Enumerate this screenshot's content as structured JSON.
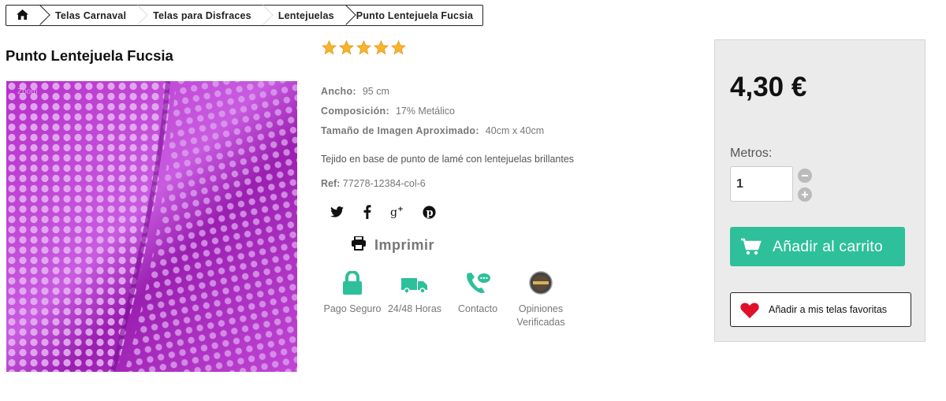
{
  "breadcrumb": {
    "home_icon": "home-icon",
    "items": [
      "Telas Carnaval",
      "Telas para Disfraces",
      "Lentejuelas",
      "Punto Lentejuela Fucsia"
    ]
  },
  "product": {
    "title": "Punto Lentejuela Fucsia",
    "zoom_hint": "Zoom",
    "rating": 5,
    "rating_max": 5,
    "specs": [
      {
        "key": "Ancho:",
        "value": "95 cm"
      },
      {
        "key": "Composición:",
        "value": "17%  Metálico"
      },
      {
        "key": "Tamaño de Imagen Aproximado:",
        "value": "40cm x 40cm"
      }
    ],
    "description": "Tejido en base de punto de lamé con lentejuelas brillantes",
    "ref_key": "Ref:",
    "ref_value": "77278-12384-col-6",
    "image_color": "#c03fd0"
  },
  "social": [
    "twitter-icon",
    "facebook-icon",
    "google-plus-icon",
    "pinterest-icon"
  ],
  "print_label": "Imprimir",
  "features": [
    {
      "label": "Pago Seguro",
      "icon": "lock-icon"
    },
    {
      "label": "24/48 Horas",
      "icon": "truck-icon"
    },
    {
      "label": "Contacto",
      "icon": "phone-chat-icon"
    },
    {
      "label": "Opiniones Verificadas",
      "icon": "verified-reviews-icon"
    }
  ],
  "purchase": {
    "price": "4,30 €",
    "quantity_label": "Metros:",
    "quantity_value": "1",
    "add_to_cart": "Añadir al carrito",
    "favorites": "Añadir a mis telas favoritas"
  },
  "colors": {
    "accent": "#2dc09a",
    "heart": "#e0102a",
    "star": "#f5b52a",
    "panel": "#ebebeb"
  }
}
